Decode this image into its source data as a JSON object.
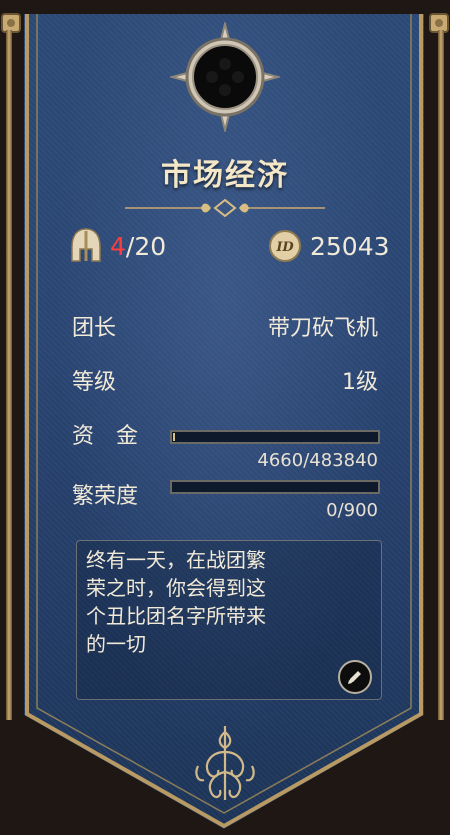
{
  "guild": {
    "name": "市场经济",
    "members_current": "4",
    "members_separator_max": "/20",
    "id_badge": "ID",
    "id_number": "25043"
  },
  "info": {
    "leader_label": "团长",
    "leader_value": "带刀砍飞机",
    "level_label": "等级",
    "level_value": "1级",
    "funds_label": "资　金",
    "funds_text": "4660/483840",
    "funds_progress": 0.0096,
    "prosperity_label": "繁荣度",
    "prosperity_text": "0/900",
    "prosperity_progress": 0
  },
  "description": {
    "line1": "终有一天，在战团繁",
    "line2": "荣之时，你会得到这",
    "line3": "个丑比团名字所带来",
    "line4": "的一切"
  },
  "icons": {
    "members": "helmet-icon",
    "id": "id-badge-icon",
    "edit": "pencil-icon"
  },
  "colors": {
    "banner": "#2a4674",
    "gold": "#c9aa72",
    "member_count": "#ff3d3d",
    "text": "#f2ead8"
  }
}
